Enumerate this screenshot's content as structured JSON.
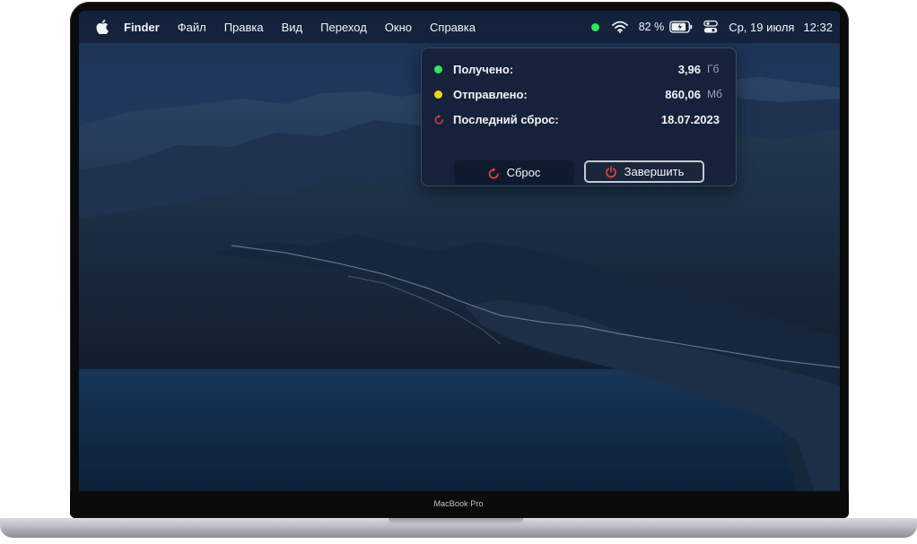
{
  "device": {
    "brand_label": "MacBook Pro"
  },
  "menubar": {
    "apple_icon": "apple-logo-icon",
    "app_name": "Finder",
    "menus": [
      "Файл",
      "Правка",
      "Вид",
      "Переход",
      "Окно",
      "Справка"
    ],
    "status": {
      "indicator_color": "#2ee85a",
      "wifi_icon": "wifi-icon",
      "battery_percent": "82 %",
      "battery_icon": "battery-charging-icon",
      "control_center_icon": "control-center-icon",
      "date": "Ср, 19 июля",
      "time": "12:32"
    }
  },
  "popover": {
    "rows": [
      {
        "label": "Получено:",
        "value": "3,96",
        "unit": "Гб",
        "dot_color": "#2ee85a"
      },
      {
        "label": "Отправлено:",
        "value": "860,06",
        "unit": "Мб",
        "dot_color": "#f5d31c"
      },
      {
        "label": "Последний сброс:",
        "value": "18.07.2023",
        "icon": "reset-icon"
      }
    ],
    "buttons": {
      "reset_label": "Сброс",
      "reset_icon": "reset-icon",
      "quit_label": "Завершить",
      "quit_icon": "power-icon"
    },
    "accent_red": "#e0453a"
  }
}
